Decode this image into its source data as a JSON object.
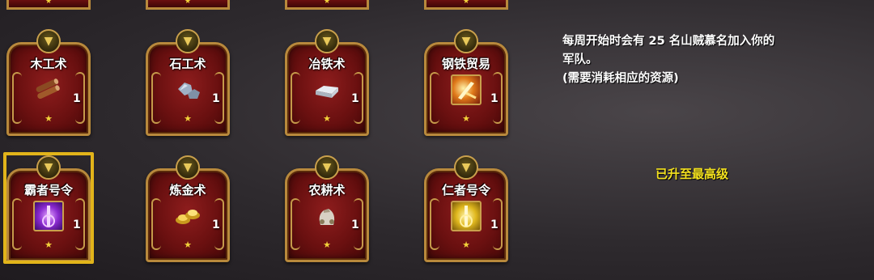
{
  "top_partial_stars": "★",
  "cards_row1": [
    {
      "name": "木工术",
      "count": "1",
      "icon": "wood-logs-icon"
    },
    {
      "name": "石工术",
      "count": "1",
      "icon": "stone-ore-icon"
    },
    {
      "name": "冶铁术",
      "count": "1",
      "icon": "iron-ingot-icon"
    },
    {
      "name": "钢铁贸易",
      "count": "1",
      "icon": "steel-trade-icon"
    }
  ],
  "cards_row2": [
    {
      "name": "霸者号令",
      "count": "1",
      "icon": "overlord-command-icon",
      "selected": true
    },
    {
      "name": "炼金术",
      "count": "1",
      "icon": "gold-ingots-icon"
    },
    {
      "name": "农耕术",
      "count": "1",
      "icon": "grain-sack-icon"
    },
    {
      "name": "仁者号令",
      "count": "1",
      "icon": "benevolent-command-icon"
    }
  ],
  "star": "★",
  "description": {
    "line1": "每周开始时会有 25 名山贼慕名加入你的",
    "line2": "军队。",
    "line3": "(需要消耗相应的资源)"
  },
  "status_text": "已升至最高级",
  "colors": {
    "accent_gold": "#e2b41a",
    "status_yellow": "#f3e11e",
    "card_red": "#7a1515"
  }
}
